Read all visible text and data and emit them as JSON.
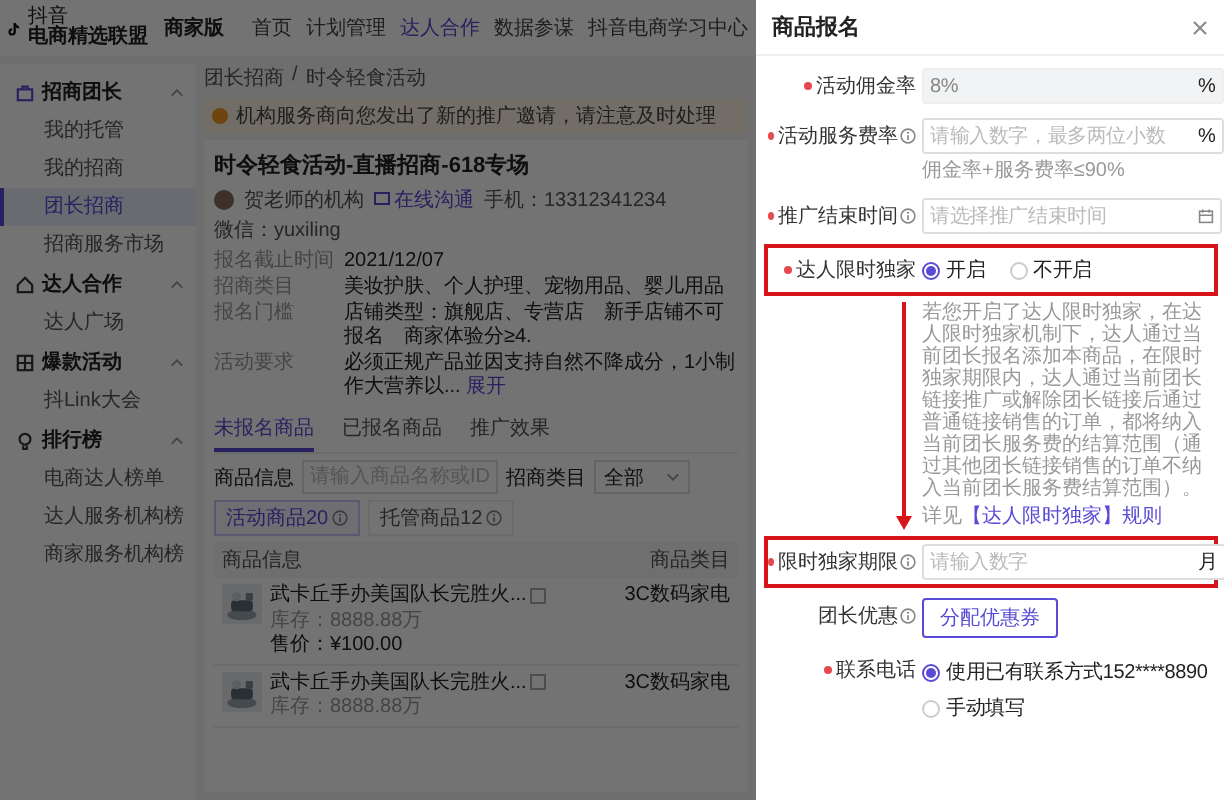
{
  "header": {
    "logo_caption": "抖音",
    "logo": "电商精选联盟",
    "edition": "商家版",
    "nav": [
      {
        "label": "首页",
        "selected": false
      },
      {
        "label": "计划管理",
        "selected": false
      },
      {
        "label": "达人合作",
        "selected": true
      },
      {
        "label": "数据参谋",
        "selected": false
      },
      {
        "label": "抖音电商学习中心",
        "selected": false
      }
    ]
  },
  "sidebar": {
    "sections": [
      {
        "title": "招商团长",
        "expanded": true,
        "items": [
          {
            "label": "我的托管",
            "selected": false
          },
          {
            "label": "我的招商",
            "selected": false
          },
          {
            "label": "团长招商",
            "selected": true
          },
          {
            "label": "招商服务市场",
            "selected": false
          }
        ]
      },
      {
        "title": "达人合作",
        "expanded": true,
        "items": [
          {
            "label": "达人广场",
            "selected": false
          }
        ]
      },
      {
        "title": "爆款活动",
        "expanded": true,
        "items": [
          {
            "label": "抖Link大会",
            "selected": false
          }
        ]
      },
      {
        "title": "排行榜",
        "expanded": true,
        "items": [
          {
            "label": "电商达人榜单",
            "selected": false
          },
          {
            "label": "达人服务机构榜",
            "selected": false
          },
          {
            "label": "商家服务机构榜",
            "selected": false
          }
        ]
      }
    ]
  },
  "main": {
    "breadcrumb": {
      "items": [
        "团长招商",
        "时令轻食活动"
      ],
      "separator": "/"
    },
    "notice": "机构服务商向您发出了新的推广邀请，请注意及时处理",
    "activity": {
      "title": "时令轻食活动-直播招商-618专场",
      "organizer": "贺老师的机构",
      "chat_link": "在线沟通",
      "phone": "手机：13312341234",
      "wechat": "微信：yuxiling",
      "details": [
        {
          "label": "报名截止时间",
          "value": "2021/12/07"
        },
        {
          "label": "招商类目",
          "value": "美妆护肤、个人护理、宠物用品、婴儿用品"
        },
        {
          "label": "报名门槛",
          "value": "店铺类型：旗舰店、专营店　新手店铺不可报名　商家体验分≥4."
        },
        {
          "label": "活动要求",
          "value": "必须正规产品並因支持自然不降成分，1小制作大营养以...",
          "link": "展开"
        }
      ]
    },
    "tabs": [
      {
        "label": "未报名商品",
        "selected": true
      },
      {
        "label": "已报名商品",
        "selected": false
      },
      {
        "label": "推广效果",
        "selected": false
      }
    ],
    "filters": [
      {
        "label": "商品信息",
        "placeholder": "请输入商品名称或ID"
      },
      {
        "label": "招商类目",
        "value": "全部"
      }
    ],
    "subtabs": [
      {
        "label": "活动商品20",
        "selected": true
      },
      {
        "label": "托管商品12",
        "selected": false
      }
    ],
    "table": {
      "columns": [
        "商品信息",
        "商品类目"
      ],
      "rows": [
        {
          "name": "武卡丘手办美国队长完胜火...",
          "stock": "库存：8888.88万",
          "price": "售价：¥100.00",
          "category": "3C数码家电"
        },
        {
          "name": "武卡丘手办美国队长完胜火...",
          "stock": "库存：8888.88万",
          "category": "3C数码家电"
        }
      ]
    }
  },
  "drawer": {
    "title": "商品报名",
    "fields": [
      {
        "kind": "input",
        "label": "活动佣金率",
        "required": true,
        "help": false,
        "highlighted": false,
        "value": "8%",
        "suffix": "%",
        "disabled": true
      },
      {
        "kind": "input",
        "label": "活动服务费率",
        "required": true,
        "help": true,
        "highlighted": false,
        "placeholder": "请输入数字，最多两位小数",
        "suffix": "%",
        "disabled": false,
        "hint": "佣金率+服务费率≤90%"
      },
      {
        "kind": "date",
        "label": "推广结束时间",
        "required": true,
        "help": true,
        "highlighted": false,
        "placeholder": "请选择推广结束时间"
      },
      {
        "kind": "radio",
        "label": "达人限时独家",
        "required": true,
        "help": false,
        "highlighted": true,
        "options": [
          {
            "label": "开启",
            "selected": true
          },
          {
            "label": "不开启",
            "selected": false
          }
        ]
      },
      {
        "kind": "note",
        "arrow": true,
        "text": "若您开启了达人限时独家，在达人限时独家机制下，达人通过当前团长报名添加本商品，在限时独家期限内，达人通过当前团长链接推广或解除团长链接后通过普通链接销售的订单，都将纳入当前团长服务费的结算范围（通过其他团长链接销售的订单不纳入当前团长服务费结算范围）。",
        "link_prefix": "详见",
        "link": "【达人限时独家】规则"
      },
      {
        "kind": "input",
        "label": "限时独家期限",
        "required": true,
        "help": true,
        "highlighted": true,
        "placeholder": "请输入数字",
        "suffix": "月",
        "disabled": false
      },
      {
        "kind": "button",
        "label": "团长优惠",
        "required": false,
        "help": true,
        "highlighted": false,
        "button": "分配优惠券"
      },
      {
        "kind": "radio_stack",
        "label": "联系电话",
        "required": true,
        "help": false,
        "highlighted": false,
        "options": [
          {
            "label": "使用已有联系方式152****8890",
            "selected": true
          },
          {
            "label": "手动填写",
            "selected": false
          }
        ]
      }
    ]
  }
}
